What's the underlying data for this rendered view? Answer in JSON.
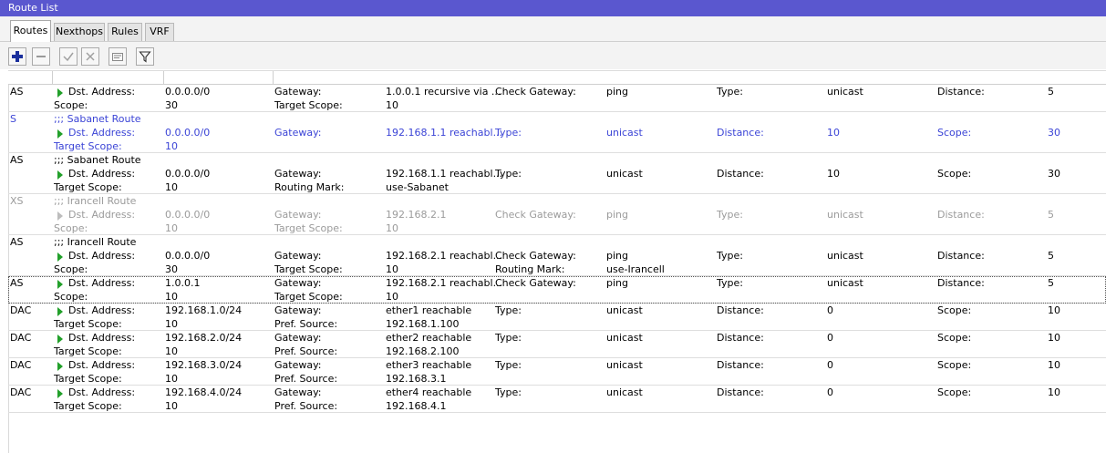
{
  "window": {
    "title": "Route List"
  },
  "tabs": [
    "Routes",
    "Nexthops",
    "Rules",
    "VRF"
  ],
  "toolbar_icons": [
    "add-icon",
    "remove-icon",
    "enable-icon",
    "disable-icon",
    "comment-icon",
    "filter-icon"
  ],
  "colors": {
    "title_bar": "#5a57cf",
    "arrow": "#22a02a",
    "static_row": "#3b44d6",
    "disabled_row": "#9b9b9b"
  },
  "routes": [
    {
      "flag": "AS",
      "cells": [
        [
          "Dst. Address:",
          "0.0.0.0/0",
          "Gateway:",
          "1.0.0.1 recursive via ...",
          "Check Gateway:",
          "ping",
          "Type:",
          "unicast",
          "Distance:",
          "5"
        ],
        [
          "Scope:",
          "30",
          "Target Scope:",
          "10"
        ]
      ]
    },
    {
      "flag": "S",
      "comment": ";;; Sabanet Route",
      "cells": [
        [
          "Dst. Address:",
          "0.0.0.0/0",
          "Gateway:",
          "192.168.1.1 reachabl...",
          "Type:",
          "unicast",
          "Distance:",
          "10",
          "Scope:",
          "30"
        ],
        [
          "Target Scope:",
          "10"
        ]
      ]
    },
    {
      "flag": "AS",
      "comment": ";;; Sabanet Route",
      "cells": [
        [
          "Dst. Address:",
          "0.0.0.0/0",
          "Gateway:",
          "192.168.1.1 reachabl...",
          "Type:",
          "unicast",
          "Distance:",
          "10",
          "Scope:",
          "30"
        ],
        [
          "Target Scope:",
          "10",
          "Routing Mark:",
          "use-Sabanet"
        ]
      ]
    },
    {
      "flag": "XS",
      "comment": ";;; Irancell Route",
      "cells": [
        [
          "Dst. Address:",
          "0.0.0.0/0",
          "Gateway:",
          "192.168.2.1",
          "Check Gateway:",
          "ping",
          "Type:",
          "unicast",
          "Distance:",
          "5"
        ],
        [
          "Scope:",
          "10",
          "Target Scope:",
          "10"
        ]
      ]
    },
    {
      "flag": "AS",
      "comment": ";;; Irancell Route",
      "cells": [
        [
          "Dst. Address:",
          "0.0.0.0/0",
          "Gateway:",
          "192.168.2.1 reachabl...",
          "Check Gateway:",
          "ping",
          "Type:",
          "unicast",
          "Distance:",
          "5"
        ],
        [
          "Scope:",
          "30",
          "Target Scope:",
          "10",
          "Routing Mark:",
          "use-Irancell"
        ]
      ]
    },
    {
      "flag": "AS",
      "cells": [
        [
          "Dst. Address:",
          "1.0.0.1",
          "Gateway:",
          "192.168.2.1 reachabl...",
          "Check Gateway:",
          "ping",
          "Type:",
          "unicast",
          "Distance:",
          "5"
        ],
        [
          "Scope:",
          "10",
          "Target Scope:",
          "10"
        ]
      ]
    },
    {
      "flag": "DAC",
      "cells": [
        [
          "Dst. Address:",
          "192.168.1.0/24",
          "Gateway:",
          "ether1 reachable",
          "Type:",
          "unicast",
          "Distance:",
          "0",
          "Scope:",
          "10"
        ],
        [
          "Target Scope:",
          "10",
          "Pref. Source:",
          "192.168.1.100"
        ]
      ]
    },
    {
      "flag": "DAC",
      "cells": [
        [
          "Dst. Address:",
          "192.168.2.0/24",
          "Gateway:",
          "ether2 reachable",
          "Type:",
          "unicast",
          "Distance:",
          "0",
          "Scope:",
          "10"
        ],
        [
          "Target Scope:",
          "10",
          "Pref. Source:",
          "192.168.2.100"
        ]
      ]
    },
    {
      "flag": "DAC",
      "cells": [
        [
          "Dst. Address:",
          "192.168.3.0/24",
          "Gateway:",
          "ether3 reachable",
          "Type:",
          "unicast",
          "Distance:",
          "0",
          "Scope:",
          "10"
        ],
        [
          "Target Scope:",
          "10",
          "Pref. Source:",
          "192.168.3.1"
        ]
      ]
    },
    {
      "flag": "DAC",
      "cells": [
        [
          "Dst. Address:",
          "192.168.4.0/24",
          "Gateway:",
          "ether4 reachable",
          "Type:",
          "unicast",
          "Distance:",
          "0",
          "Scope:",
          "10"
        ],
        [
          "Target Scope:",
          "10",
          "Pref. Source:",
          "192.168.4.1"
        ]
      ]
    }
  ]
}
